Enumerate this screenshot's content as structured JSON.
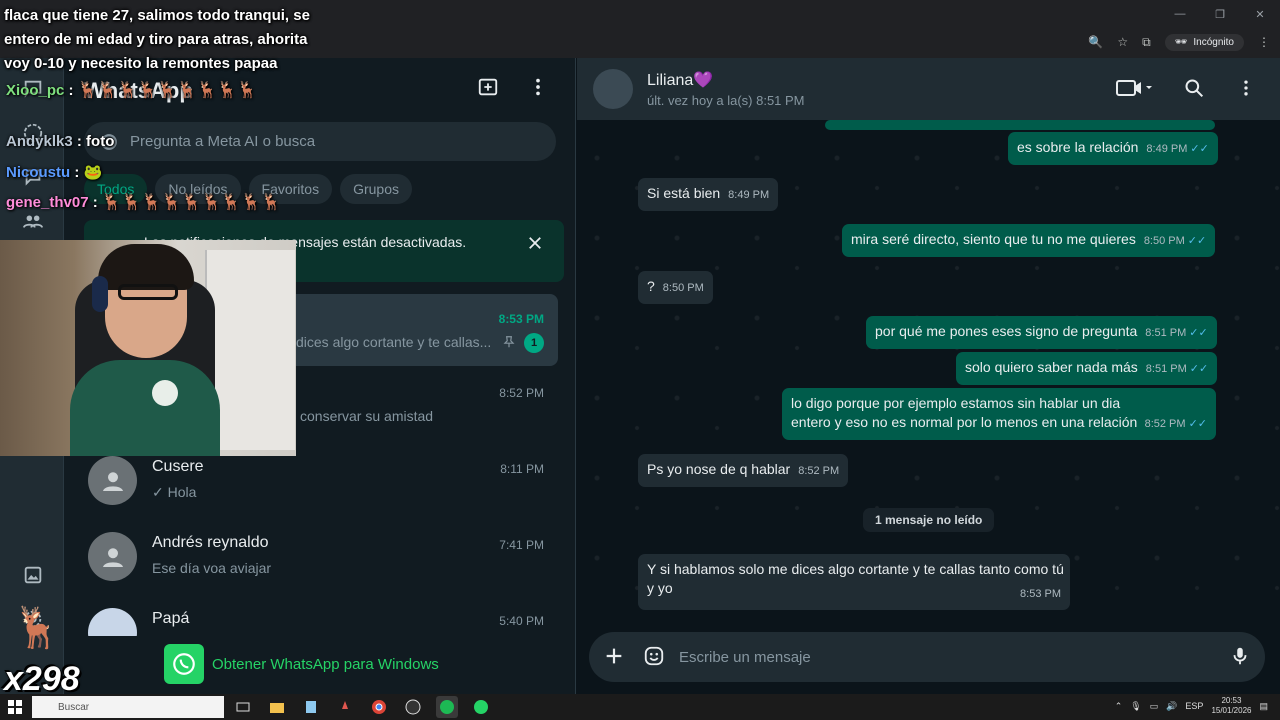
{
  "browser": {
    "incognito_label": "Incógnito"
  },
  "stream_overlay": {
    "top_text": "flaca que tiene 27, salimos todo tranqui, se entero de mi edad y tiro para atras, ahorita voy 0-10 y necesito la remontes papaa",
    "chat": [
      {
        "user": "Xioo_pc",
        "msg": "🦌🦌🦌🦌🦌🦌🦌🦌🦌",
        "color": "#7fe07f"
      },
      {
        "user": "Andyklk3",
        "msg": "foto",
        "color": "#b9c6d3"
      },
      {
        "user": "Nicoustu",
        "msg": "🐸",
        "color": "#5b9bff"
      },
      {
        "user": "gene_thv07",
        "msg": "🦌🦌🦌🦌🦌🦌🦌🦌🦌",
        "color": "#ff8cd9"
      }
    ],
    "multiplier": "x298"
  },
  "app": {
    "title": "WhatsApp",
    "search_placeholder": "Pregunta a Meta AI o busca",
    "chips": [
      "Todos",
      "No leídos",
      "Favoritos",
      "Grupos"
    ],
    "notification": "Las notificaciones de mensajes están desactivadas.",
    "get_app": "Obtener WhatsApp para Windows"
  },
  "chats": [
    {
      "name": "",
      "time": "8:53 PM",
      "preview": "dices algo cortante y te callas...",
      "unread": "1"
    },
    {
      "name": "",
      "time": "8:52 PM",
      "preview": "conservar su amistad"
    },
    {
      "name": "Cusere",
      "time": "8:11 PM",
      "preview": "✓ Hola"
    },
    {
      "name": "Andrés reynaldo",
      "time": "7:41 PM",
      "preview": "Ese día voa aviajar"
    },
    {
      "name": "Papá",
      "time": "5:40 PM",
      "preview": ""
    }
  ],
  "conversation": {
    "contact": "Liliana💜",
    "status": "últ. vez hoy a la(s) 8:51 PM",
    "unread_divider": "1 mensaje no leído",
    "composer_placeholder": "Escribe un mensaje",
    "messages": [
      {
        "dir": "out",
        "text": "es sobre la relación",
        "time": "8:49 PM"
      },
      {
        "dir": "in",
        "text": "Si está bien",
        "time": "8:49 PM"
      },
      {
        "dir": "out",
        "text": "mira seré directo, siento que tu no me quieres",
        "time": "8:50 PM"
      },
      {
        "dir": "in",
        "text": "?",
        "time": "8:50 PM"
      },
      {
        "dir": "out",
        "text": "por qué me pones eses signo de pregunta",
        "time": "8:51 PM"
      },
      {
        "dir": "out",
        "text": "solo quiero saber nada más",
        "time": "8:51 PM"
      },
      {
        "dir": "out",
        "text": "lo digo porque por ejemplo estamos sin hablar un dia entero y eso no es normal por lo menos en una relación",
        "time": "8:52 PM"
      },
      {
        "dir": "in",
        "text": "Ps yo nose de q hablar",
        "time": "8:52 PM"
      },
      {
        "dir": "in",
        "text": "Y si hablamos solo me dices algo cortante y te callas tanto como tú y yo",
        "time": "8:53 PM"
      }
    ]
  },
  "taskbar": {
    "search_label": "Buscar",
    "lang": "ESP",
    "time": "20:53",
    "date": "15/01/2026"
  },
  "colors": {
    "accent": "#00a884",
    "outgoing": "#005c4b",
    "incoming": "#202c33",
    "read_tick": "#53bdeb"
  }
}
